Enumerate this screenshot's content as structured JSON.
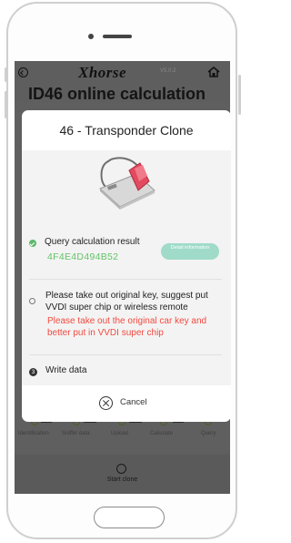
{
  "app": {
    "logo_text": "Xhorse",
    "logo_version": "V5.0.2",
    "page_title": "ID46 online calculation"
  },
  "dialog": {
    "title": "46 - Transponder Clone",
    "query_label": "Query calculation result",
    "result_value": "4F4E4D494B52",
    "detail_label": "Detail information",
    "instruction": "Please take out original key, suggest put VVDI super chip or wireless remote",
    "warning": "Please take out the original car key and better put in VVDI super chip",
    "write_number": "3",
    "write_label": "Write data",
    "cancel_label": "Cancel"
  },
  "steps": [
    {
      "label": "Identification"
    },
    {
      "label": "Sniffer data"
    },
    {
      "label": "Upload"
    },
    {
      "label": "Calculate"
    },
    {
      "label": "Query"
    }
  ],
  "footer": {
    "start_label": "Start clone"
  },
  "colors": {
    "success_green": "#63c468",
    "warning_red": "#f24a40",
    "detail_button": "#9fdbc8",
    "overlay_gray": "#5f5f5f"
  }
}
